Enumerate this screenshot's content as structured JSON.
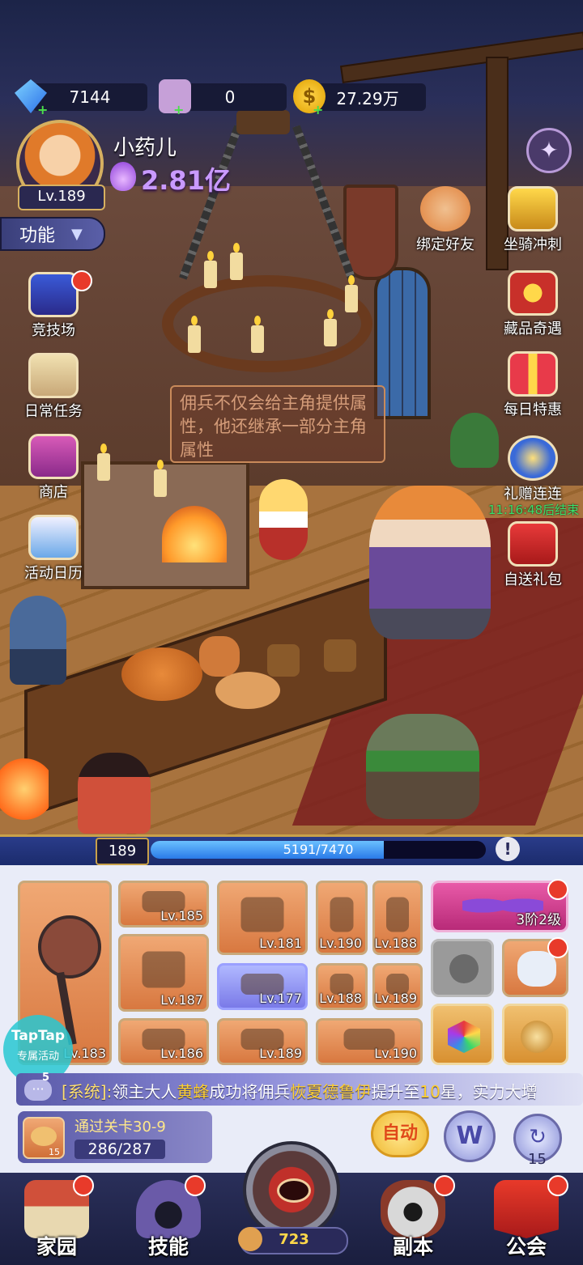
{
  "currencies": {
    "gems": "7144",
    "scrolls": "0",
    "gold": "27.29万"
  },
  "player": {
    "name": "小药儿",
    "level": "Lv.189",
    "power": "2.81亿"
  },
  "function_menu": "功能",
  "left_menu": [
    {
      "label": "竞技场"
    },
    {
      "label": "日常任务"
    },
    {
      "label": "商店"
    },
    {
      "label": "活动日历"
    }
  ],
  "right_menu": [
    {
      "label": "绑定好友"
    },
    {
      "label": "坐骑冲刺"
    },
    {
      "label": "藏品奇遇"
    },
    {
      "label": "每日特惠"
    },
    {
      "label": "礼赠连连"
    },
    {
      "label": "自送礼包"
    }
  ],
  "event_timer": "11:16:48后结束",
  "tooltip": "佣兵不仅会给主角提供属性，他还继承一部分主角属性",
  "xp": {
    "level": "189",
    "text": "5191/7470",
    "current": 5191,
    "max": 7470
  },
  "equipment": {
    "weapon_level": "Lv.183",
    "items": [
      "Lv.185",
      "Lv.187",
      "Lv.186",
      "Lv.181",
      "Lv.177",
      "Lv.189",
      "Lv.190",
      "Lv.188",
      "Lv.188",
      "Lv.189",
      "Lv.190"
    ],
    "wings_label": "3阶2级"
  },
  "ticker": {
    "badge": "5",
    "prefix": "[系统]:",
    "text1": "领主大人",
    "name1": "黄蜂",
    "text2": "成功将佣兵",
    "name2": "恢夏德鲁伊",
    "text3": "提升至",
    "num": "10",
    "text4": "星，实力大增"
  },
  "stage": {
    "title": "通过关卡30-9",
    "icon_count": "15",
    "progress": "286/287"
  },
  "auto_label": "自动",
  "w_label": "W",
  "refresh_count": "15",
  "taptap": {
    "line1": "TapTap",
    "line2": "专属活动"
  },
  "nav": [
    {
      "label": "家园"
    },
    {
      "label": "技能"
    },
    {
      "label": "副本"
    },
    {
      "label": "公会"
    }
  ],
  "energy": "723",
  "colors": {
    "accent_gold": "#c9a14a",
    "notification_red": "#e83a2a",
    "power_purple": "#c99aff",
    "timer_green": "#3ae06a"
  }
}
